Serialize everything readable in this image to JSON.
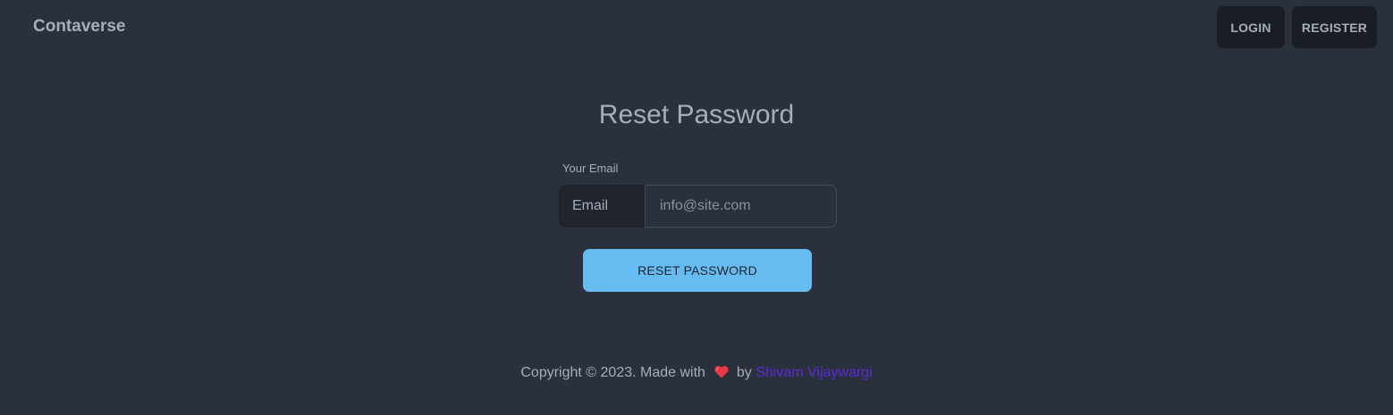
{
  "navbar": {
    "brand": "Contaverse",
    "login_label": "LOGIN",
    "register_label": "REGISTER"
  },
  "main": {
    "title": "Reset Password",
    "email_label": "Your Email",
    "email_addon": "Email",
    "email_placeholder": "info@site.com",
    "email_value": "",
    "reset_button_label": "RESET PASSWORD"
  },
  "footer": {
    "text_before": "Copyright © 2023. Made with",
    "text_by": "by",
    "author": "Shivam Vijaywargi",
    "heart_icon": "heart-icon"
  },
  "colors": {
    "background": "#2a303c",
    "nav_button": "#191d24",
    "primary": "#66bbf1",
    "link": "#5a2bd8",
    "heart": "#e63946"
  }
}
